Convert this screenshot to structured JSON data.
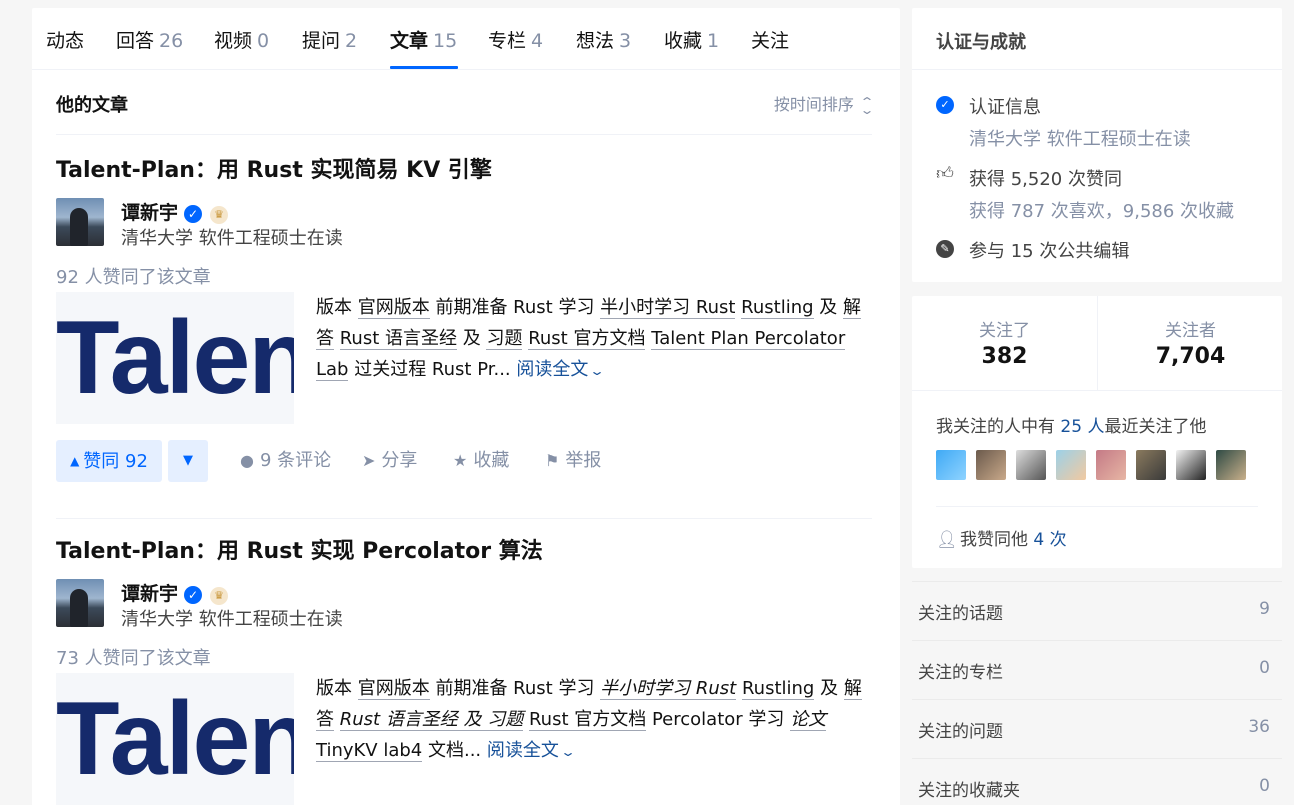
{
  "tabs": [
    {
      "label": "动态",
      "count": ""
    },
    {
      "label": "回答",
      "count": "26"
    },
    {
      "label": "视频",
      "count": "0"
    },
    {
      "label": "提问",
      "count": "2"
    },
    {
      "label": "文章",
      "count": "15"
    },
    {
      "label": "专栏",
      "count": "4"
    },
    {
      "label": "想法",
      "count": "3"
    },
    {
      "label": "收藏",
      "count": "1"
    },
    {
      "label": "关注",
      "count": ""
    }
  ],
  "active_tab": "文章",
  "section": {
    "title": "他的文章",
    "sort_label": "按时间排序",
    "sort_icon": "sort-updown-icon"
  },
  "articles": [
    {
      "title": "Talent-Plan：用 Rust 实现简易 KV 引擎",
      "author": {
        "name": "谭新宇",
        "bio": "清华大学 软件工程硕士在读"
      },
      "likes_line": "92 人赞同了该文章",
      "thumb_text": "Talent",
      "excerpt": {
        "t1": "版本 ",
        "l1": "官网版本",
        "t2": " 前期准备 Rust 学习 ",
        "l2": "半小时学习 Rust",
        "t3": " ",
        "l3": "Rustling",
        "t4": " 及 ",
        "l4": "解答",
        "t5": " ",
        "l5": "Rust 语言圣经",
        "t6": " 及 ",
        "l6": "习题",
        "t7": " ",
        "l7": "Rust 官方文档",
        "t8": " ",
        "l8": "Talent Plan Percolator Lab",
        "t9": " 过关过程 Rust Pr...",
        "read_more": "阅读全文"
      },
      "vote_up": "赞同 92",
      "comments": "9 条评论",
      "share": "分享",
      "favorite": "收藏",
      "report": "举报"
    },
    {
      "title": "Talent-Plan：用 Rust 实现 Percolator 算法",
      "author": {
        "name": "谭新宇",
        "bio": "清华大学 软件工程硕士在读"
      },
      "likes_line": "73 人赞同了该文章",
      "thumb_text": "Talent",
      "excerpt": {
        "t1": "版本 ",
        "l1": "官网版本",
        "t2": " 前期准备 Rust 学习 ",
        "i1": "半小时学习 Rust",
        "t3": " ",
        "l2": "Rustling",
        "t4": " 及 ",
        "l3": "解答",
        "t5": " ",
        "i2": "Rust 语言圣经 及 ",
        "i3": "习题",
        "t6": " ",
        "l4": "Rust 官方文档",
        "t7": " Percolator 学习 ",
        "i4": "论文",
        "t8": " ",
        "l5": "TinyKV lab4",
        "t9": " 文档...",
        "read_more": "阅读全文"
      }
    }
  ],
  "achievements": {
    "title": "认证与成就",
    "cert_label": "认证信息",
    "cert_value": "清华大学 软件工程硕士在读",
    "approve_main": "获得 5,520 次赞同",
    "approve_sub": "获得 787 次喜欢，9,586 次收藏",
    "edit": "参与 15 次公共编辑"
  },
  "follow": {
    "following_label": "关注了",
    "following_count": "382",
    "followers_label": "关注者",
    "followers_count": "7,704",
    "recent_prefix": "我关注的人中有 ",
    "recent_count": "25 人",
    "recent_suffix": "最近关注了他",
    "approve_prefix": "我赞同他 ",
    "approve_count": "4 次"
  },
  "side_list": [
    {
      "label": "关注的话题",
      "count": "9"
    },
    {
      "label": "关注的专栏",
      "count": "0"
    },
    {
      "label": "关注的问题",
      "count": "36"
    },
    {
      "label": "关注的收藏夹",
      "count": "0"
    }
  ],
  "colors": {
    "accent": "#0066ff",
    "link": "#175199",
    "muted": "#8590a6",
    "thumb_text": "#152a6b"
  }
}
